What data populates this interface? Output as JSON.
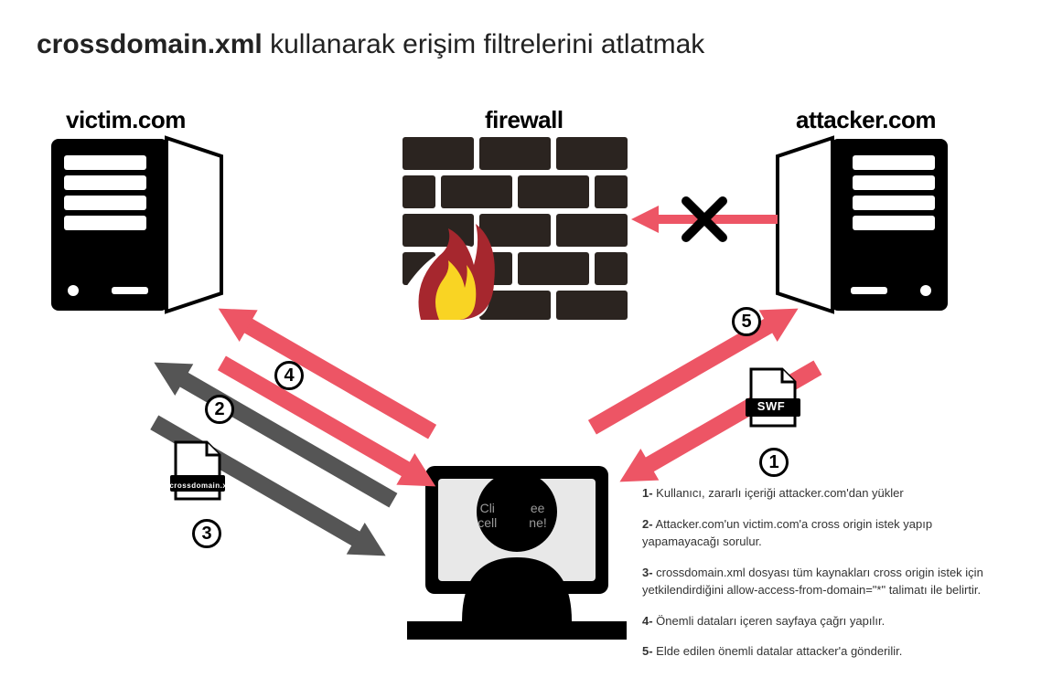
{
  "title": {
    "bold": "crossdomain.xml",
    "rest": " kullanarak erişim filtrelerini atlatmak"
  },
  "labels": {
    "victim": "victim.com",
    "firewall": "firewall",
    "attacker": "attacker.com"
  },
  "files": {
    "crossdomain": "crossdomain.xml",
    "swf": "SWF"
  },
  "screen": {
    "l1": "Cli",
    "l2": "ee",
    "l3": "cell",
    "l4": "ne!"
  },
  "steps": {
    "s1": {
      "num": "1-",
      "text": " Kullanıcı, zararlı içeriği attacker.com'dan yükler"
    },
    "s2": {
      "num": "2-",
      "text": " Attacker.com'un victim.com'a cross origin istek yapıp yapamayacağı sorulur."
    },
    "s3": {
      "num": "3-",
      "text": " crossdomain.xml dosyası tüm kaynakları cross origin istek için yetkilendirdiğini allow-access-from-domain=\"*\" talimatı ile belirtir."
    },
    "s4": {
      "num": "4-",
      "text": " Önemli dataları içeren sayfaya çağrı yapılır."
    },
    "s5": {
      "num": "5-",
      "text": " Elde edilen önemli datalar attacker'a gönderilir."
    }
  },
  "colors": {
    "red": "#ed5565",
    "gray": "#555",
    "dark": "#2b2420",
    "flameY": "#f9d423",
    "flameR": "#a6272e"
  },
  "badges": {
    "b1": "1",
    "b2": "2",
    "b3": "3",
    "b4": "4",
    "b5": "5"
  }
}
